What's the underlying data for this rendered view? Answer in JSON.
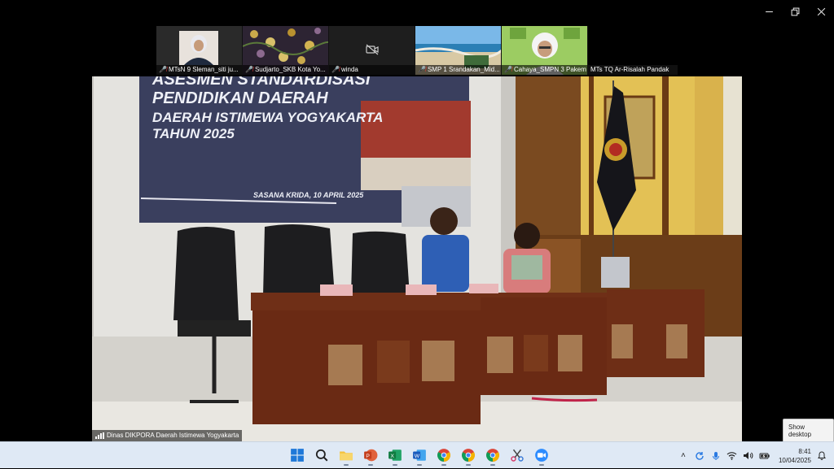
{
  "window": {
    "controls": {
      "minimize": "–",
      "maximize": "❐",
      "close": "✕"
    }
  },
  "gallery": {
    "tiles": [
      {
        "name": "MTsN 9 Sleman_siti ju..."
      },
      {
        "name": "Sudjarto_SKB Kota Yo..."
      },
      {
        "name": "winda"
      },
      {
        "name": "SMP 1 Srandakan_Mid..."
      },
      {
        "name": "Cahaya_SMPN 3 Pakem"
      },
      {
        "name": "MTs TQ Ar-Risalah Pandak"
      }
    ]
  },
  "stage": {
    "label": "Dinas DIKPORA Daerah Istimewa Yogyakarta",
    "screen": {
      "line1": "ASESMEN STANDARDISASI",
      "line2": "PENDIDIKAN DAERAH",
      "line3": "DAERAH ISTIMEWA YOGYAKARTA",
      "line4": "TAHUN 2025",
      "footer": "SASANA KRIDA, 10 APRIL 2025"
    }
  },
  "tooltip": {
    "text": "Show desktop"
  },
  "taskbar": {
    "time": "8:41",
    "date": "10/04/2025",
    "icons": [
      "windows-start",
      "search",
      "file-explorer",
      "powerpoint",
      "excel",
      "word",
      "chrome",
      "chrome",
      "chrome",
      "snipping-tool",
      "zoom"
    ]
  }
}
